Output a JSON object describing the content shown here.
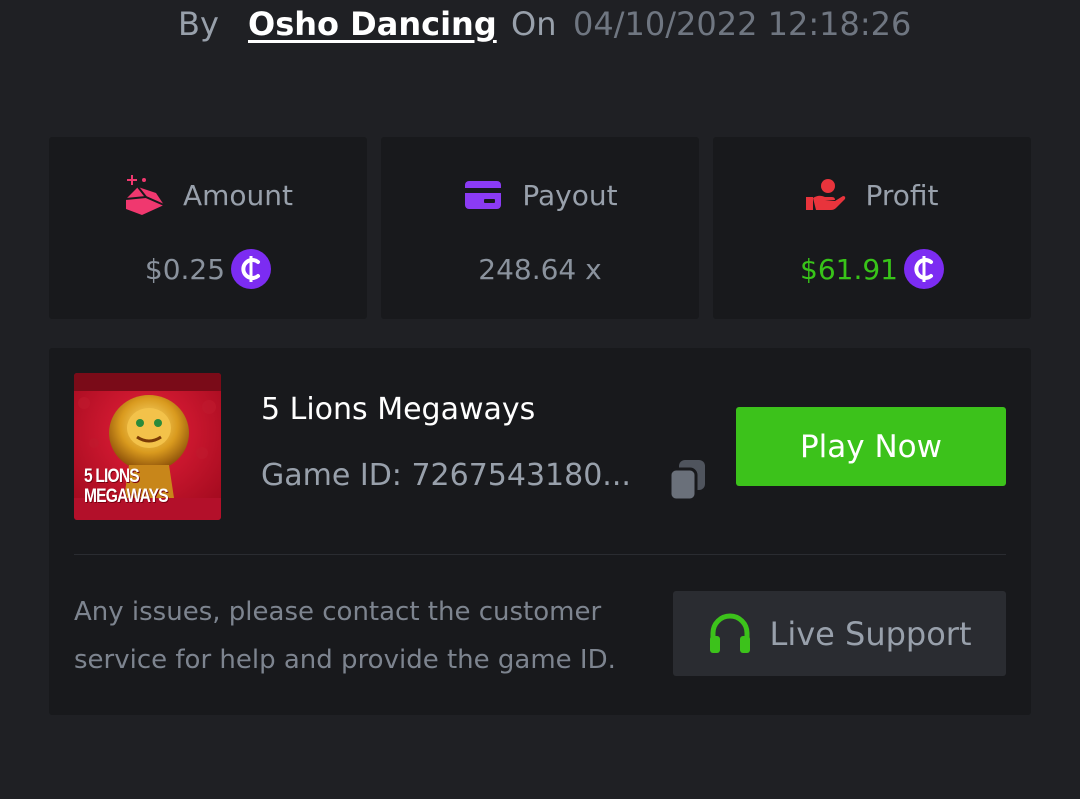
{
  "header": {
    "by_label": "By",
    "username": "Osho Dancing",
    "on_label": "On",
    "timestamp": "04/10/2022 12:18:26"
  },
  "stats": [
    {
      "label": "Amount",
      "value": "$0.25",
      "icon": "gem-icon",
      "currency_icon": "coin-icon"
    },
    {
      "label": "Payout",
      "value": "248.64 x",
      "icon": "card-icon"
    },
    {
      "label": "Profit",
      "value": "$61.91",
      "icon": "hand-coin-icon",
      "currency_icon": "coin-icon"
    }
  ],
  "game": {
    "thumbnail_text": "5 LIONS\nMEGAWAYS",
    "title": "5 Lions Megaways",
    "id_text": "Game ID: 7267543180...",
    "play_label": "Play Now",
    "help_text": "Any issues, please contact the customer service for help and provide the game ID.",
    "support_label": "Live Support"
  },
  "colors": {
    "background": "#1f2024",
    "card": "#18191c",
    "accent_green": "#3cc21b",
    "profit_green": "#38c419",
    "coin_purple": "#7c2cf2",
    "amount_pink": "#f0386f",
    "payout_purple": "#8b3bf4",
    "profit_red": "#e8343c"
  }
}
